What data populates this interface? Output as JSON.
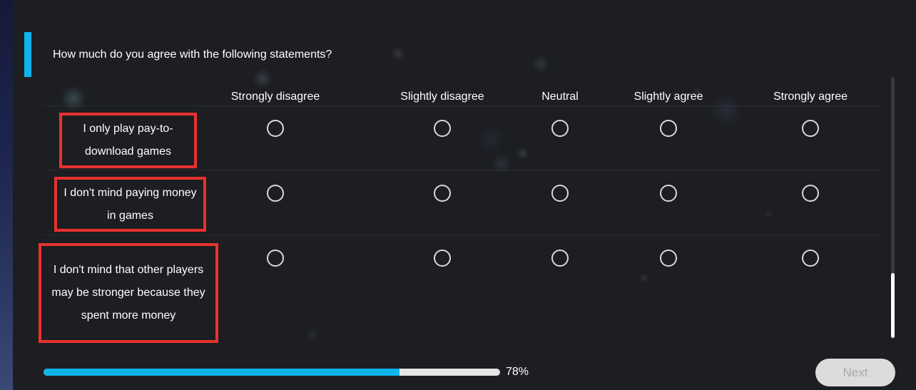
{
  "survey": {
    "question": "How much do you agree with the following statements?",
    "columns": [
      "Strongly disagree",
      "Slightly disagree",
      "Neutral",
      "Slightly agree",
      "Strongly agree"
    ],
    "rows": [
      {
        "label": "I only play pay-to-download games",
        "selected": null
      },
      {
        "label": "I don't mind paying money in games",
        "selected": null
      },
      {
        "label": "I don't mind that other players may be stronger because they spent more money",
        "selected": null
      }
    ]
  },
  "progress": {
    "value": 0.78,
    "label": "78%"
  },
  "footer": {
    "next_label": "Next"
  },
  "colors": {
    "accent": "#0fb4ea",
    "highlight_border": "#e8322f",
    "next_disabled_bg": "#dcdcdc",
    "next_disabled_text": "#a9a9a9"
  }
}
